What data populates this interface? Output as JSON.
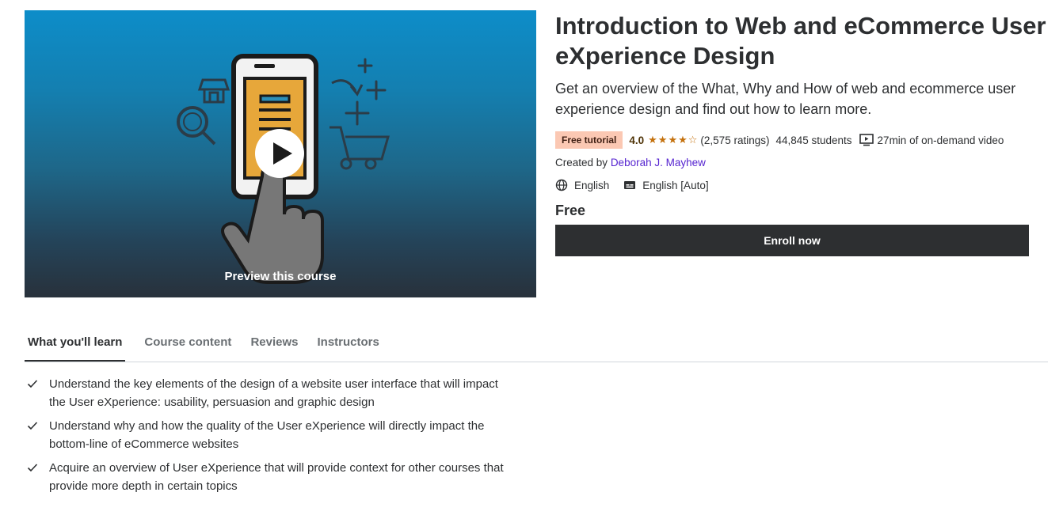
{
  "preview": {
    "label": "Preview this course"
  },
  "course": {
    "title": "Introduction to Web and eCommerce User eXperience Design",
    "subtitle": "Get an overview of the What, Why and How of web and ecommerce user experience design and find out how to learn more.",
    "badge": "Free tutorial",
    "rating": "4.0",
    "stars": 4,
    "ratings_count": "(2,575 ratings)",
    "students": "44,845 students",
    "video": "27min of on-demand video",
    "created_by_label": "Created by",
    "instructor": "Deborah J. Mayhew",
    "language": "English",
    "captions": "English [Auto]",
    "price": "Free",
    "enroll_label": "Enroll now"
  },
  "tabs": [
    {
      "label": "What you'll learn",
      "active": true
    },
    {
      "label": "Course content",
      "active": false
    },
    {
      "label": "Reviews",
      "active": false
    },
    {
      "label": "Instructors",
      "active": false
    }
  ],
  "learn": [
    "Understand the key elements of the design of a website user interface that will impact the User eXperience: usability, persuasion and graphic design",
    "Understand why and how the quality of the User eXperience will directly impact the bottom-line of eCommerce websites",
    "Acquire an overview of User eXperience that will provide context for other courses that provide more depth in certain topics"
  ],
  "icons": {
    "star": "star-icon",
    "video": "video-icon",
    "globe": "globe-icon",
    "captions": "captions-icon",
    "check": "check-icon",
    "play": "play-icon"
  },
  "colors": {
    "accent": "#5624d0",
    "badge_bg": "#fbc8b3",
    "star": "#c4710d",
    "button": "#2d2f31"
  }
}
